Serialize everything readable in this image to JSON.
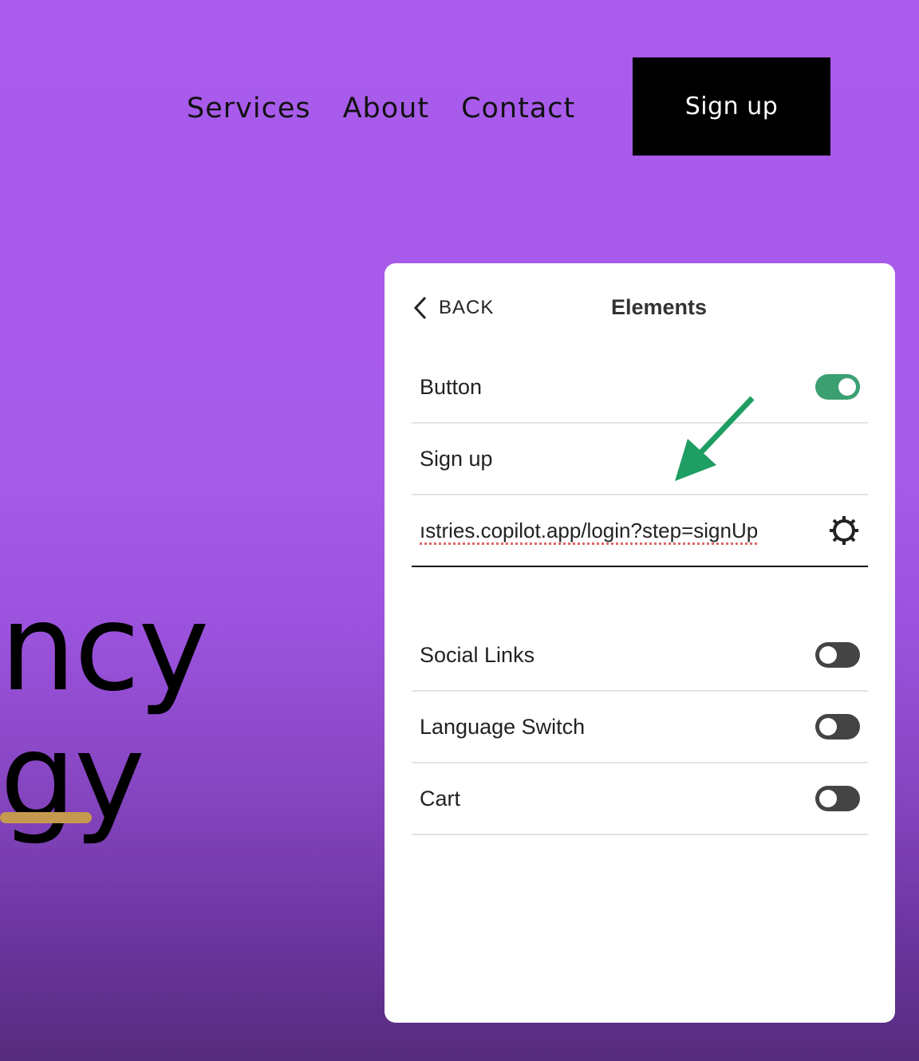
{
  "nav": {
    "items": [
      "Services",
      "About",
      "Contact"
    ],
    "signup": "Sign up"
  },
  "hero": {
    "line1": "ncy",
    "line2": "gy"
  },
  "panel": {
    "back": "BACK",
    "title": "Elements",
    "rows": [
      {
        "label": "Button",
        "toggle": true
      },
      {
        "label": "Sign up"
      },
      {
        "url": "ıstries.copilot.app/login?step=signUp"
      },
      {
        "label": "Social Links",
        "toggle": false
      },
      {
        "label": "Language Switch",
        "toggle": false
      },
      {
        "label": "Cart",
        "toggle": false
      }
    ]
  },
  "colors": {
    "background": "#a95bec",
    "toggle_on": "#3b9f72",
    "arrow": "#1f9e63",
    "underline": "#c5994e"
  }
}
